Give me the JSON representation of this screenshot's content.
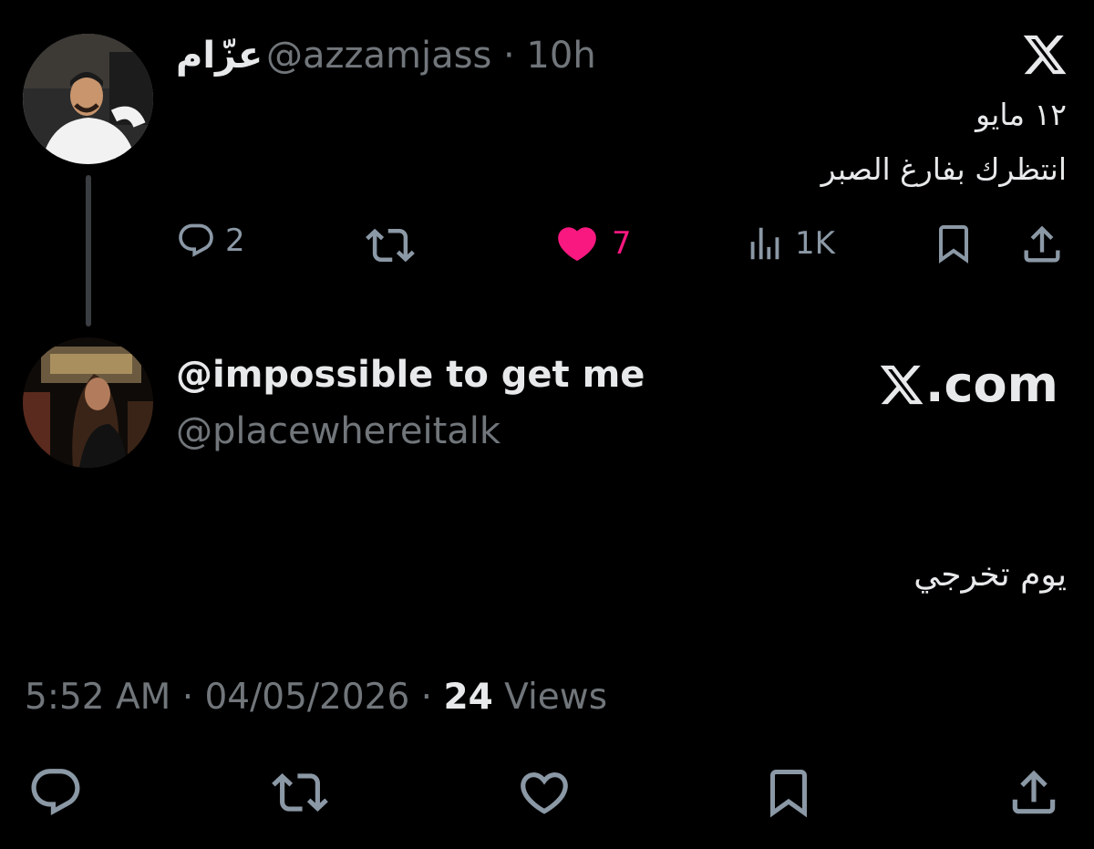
{
  "tweet1": {
    "display_name": "عزّام",
    "handle_time": "@azzamjass · 10h",
    "line1": "١٢ مايو",
    "line2": "انتظرك بفارغ الصبر",
    "reply_count": "2",
    "like_count": "7",
    "views_count": "1K"
  },
  "tweet2": {
    "display_name": "@impossible to get me",
    "handle": "@placewhereitalk",
    "brand": ".com",
    "text": "يوم تخرجي",
    "timestamp": "5:52 AM · 04/05/2026 · ",
    "views_number": "24",
    "views_label": " Views"
  },
  "colors": {
    "background": "#000000",
    "primary_text": "#e7e9ea",
    "secondary_text": "#71767b",
    "icon_gray": "#8b98a5",
    "like_pink": "#f91880"
  },
  "icons": [
    "x-logo-icon",
    "reply-icon",
    "retweet-icon",
    "heart-icon",
    "views-icon",
    "bookmark-icon",
    "share-icon"
  ]
}
